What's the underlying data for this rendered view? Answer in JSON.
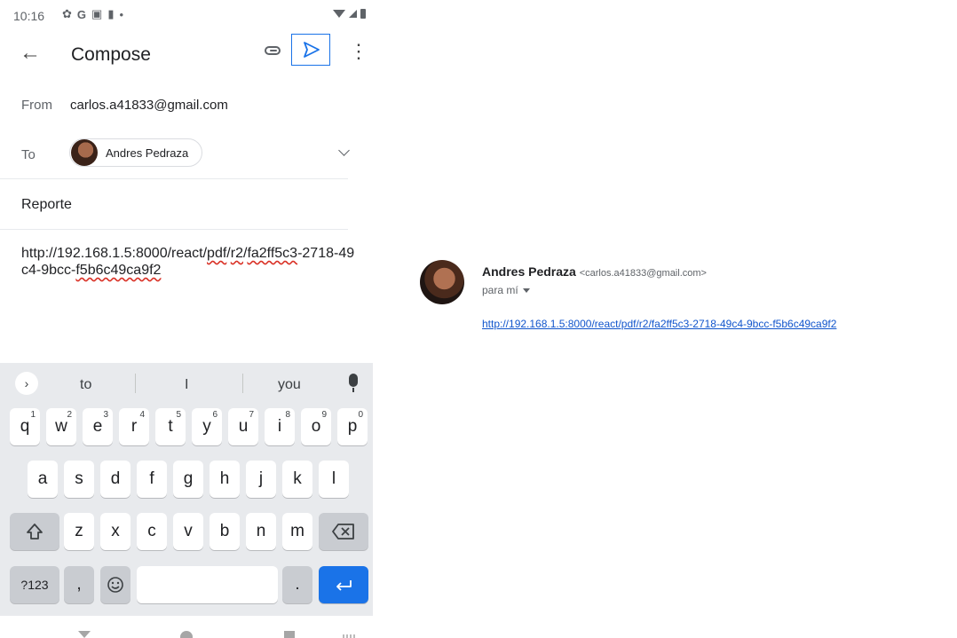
{
  "status_bar": {
    "time": "10:16"
  },
  "compose": {
    "title": "Compose",
    "from_label": "From",
    "from_value": "carlos.a41833@gmail.com",
    "to_label": "To",
    "to_chip": "Andres Pedraza",
    "subject": "Reporte",
    "body_parts": [
      "http://192.168.1.5:8000/react/",
      "pdf",
      "/",
      "r2",
      "/",
      "fa2ff5c3",
      "-2718-49c4-9bcc-",
      "f5b6c49ca9f2"
    ]
  },
  "keyboard": {
    "suggestions": [
      "to",
      "I",
      "you"
    ],
    "row1": [
      "q",
      "w",
      "e",
      "r",
      "t",
      "y",
      "u",
      "i",
      "o",
      "p"
    ],
    "row1_nums": [
      "1",
      "2",
      "3",
      "4",
      "5",
      "6",
      "7",
      "8",
      "9",
      "0"
    ],
    "row2": [
      "a",
      "s",
      "d",
      "f",
      "g",
      "h",
      "j",
      "k",
      "l"
    ],
    "row3": [
      "z",
      "x",
      "c",
      "v",
      "b",
      "n",
      "m"
    ],
    "symbols_key": "?123",
    "comma_key": ",",
    "period_key": "."
  },
  "email_preview": {
    "sender_name": "Andres Pedraza",
    "sender_email": "<carlos.a41833@gmail.com>",
    "to_me": "para mí",
    "link": "http://192.168.1.5:8000/react/pdf/r2/fa2ff5c3-2718-49c4-9bcc-f5b6c49ca9f2"
  },
  "icons": [
    "settings-icon",
    "google-icon",
    "gallery-icon",
    "sd-card-icon",
    "wifi-icon",
    "signal-icon",
    "battery-icon",
    "back-arrow-icon",
    "attach-icon",
    "send-icon",
    "more-vert-icon",
    "chevron-down-icon",
    "expand-icon",
    "mic-icon",
    "shift-icon",
    "backspace-icon",
    "emoji-icon",
    "enter-icon"
  ],
  "colors": {
    "accent": "#1a73e8",
    "link": "#1155cc",
    "keyboard_bg": "#e8eaed"
  }
}
